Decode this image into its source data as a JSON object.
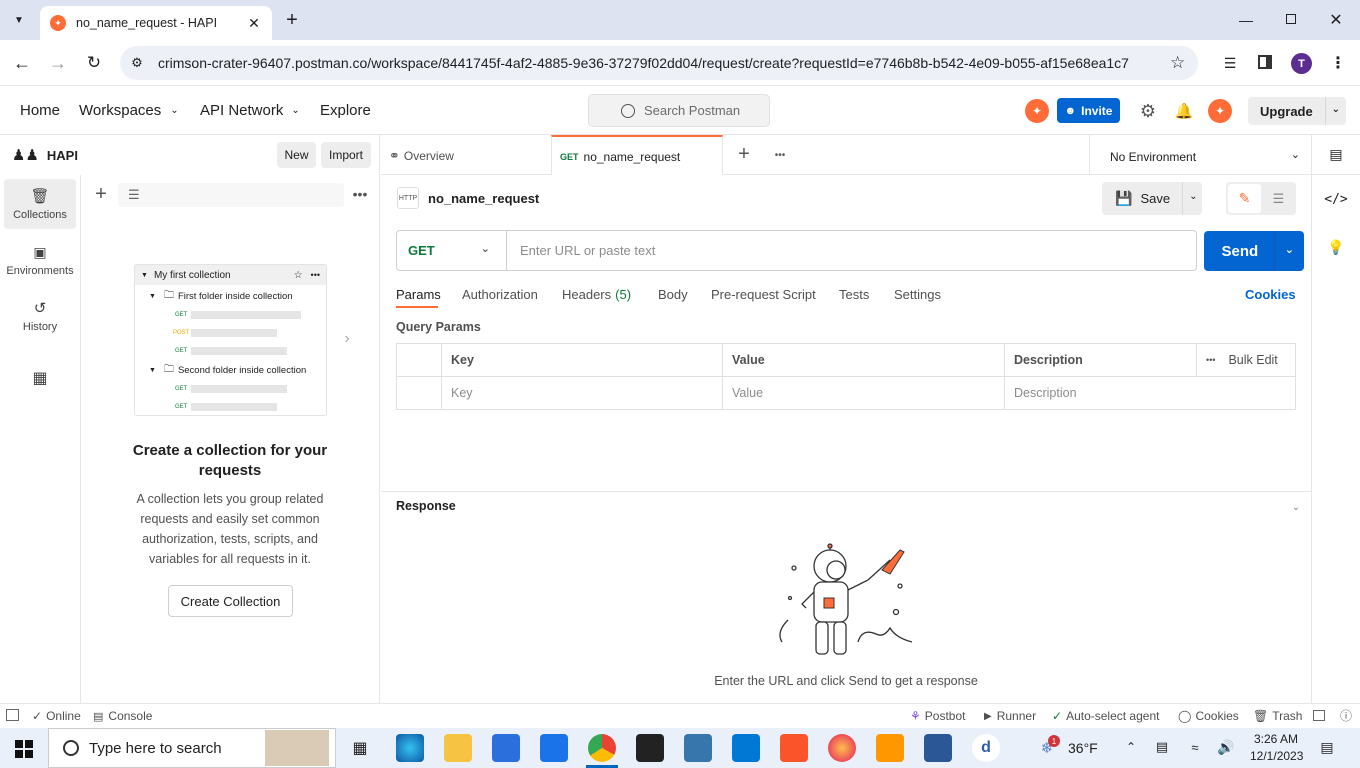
{
  "browser": {
    "tab_title": "no_name_request - HAPI",
    "url": "crimson-crater-96407.postman.co/workspace/8441745f-4af2-4885-9e36-37279f02dd04/request/create?requestId=e7746b8b-b542-4e09-b055-af15e68ea1c7",
    "profile_initial": "T"
  },
  "header": {
    "home": "Home",
    "workspaces": "Workspaces",
    "api_network": "API Network",
    "explore": "Explore",
    "search_placeholder": "Search Postman",
    "invite": "Invite",
    "upgrade": "Upgrade"
  },
  "sidebar": {
    "workspace_name": "HAPI",
    "new": "New",
    "import": "Import",
    "rail": [
      {
        "label": "Collections",
        "icon": "collections-icon"
      },
      {
        "label": "Environments",
        "icon": "environments-icon"
      },
      {
        "label": "History",
        "icon": "history-icon"
      }
    ],
    "illustration": {
      "collection": "My first collection",
      "folder1": "First folder inside collection",
      "folder2": "Second folder inside collection",
      "methods": [
        "GET",
        "POST",
        "GET",
        "GET",
        "GET"
      ]
    },
    "empty_title": "Create a collection for your requests",
    "empty_desc": "A collection lets you group related requests and easily set common authorization, tests, scripts, and variables for all requests in it.",
    "create_button": "Create Collection"
  },
  "tabs": {
    "overview": "Overview",
    "active_method": "GET",
    "active_name": "no_name_request",
    "environment": "No Environment"
  },
  "request": {
    "name": "no_name_request",
    "save": "Save",
    "method": "GET",
    "url_placeholder": "Enter URL or paste text",
    "send": "Send",
    "subtabs": [
      "Params",
      "Authorization",
      "Headers",
      "Body",
      "Pre-request Script",
      "Tests",
      "Settings"
    ],
    "headers_count": "(5)",
    "cookies": "Cookies",
    "query_params_title": "Query Params",
    "columns": [
      "Key",
      "Value",
      "Description"
    ],
    "bulk_edit": "Bulk Edit",
    "row_placeholders": [
      "Key",
      "Value",
      "Description"
    ]
  },
  "response": {
    "title": "Response",
    "empty": "Enter the URL and click Send to get a response"
  },
  "statusbar": {
    "online": "Online",
    "console": "Console",
    "postbot": "Postbot",
    "runner": "Runner",
    "agent": "Auto-select agent",
    "cookies": "Cookies",
    "trash": "Trash"
  },
  "taskbar": {
    "search_placeholder": "Type here to search",
    "weather": "36°F",
    "weather_badge": "1",
    "time": "3:26 AM",
    "date": "12/1/2023"
  },
  "colors": {
    "accent": "#ff6c37",
    "send_blue": "#0265d2",
    "get_green": "#0d7a3a"
  }
}
